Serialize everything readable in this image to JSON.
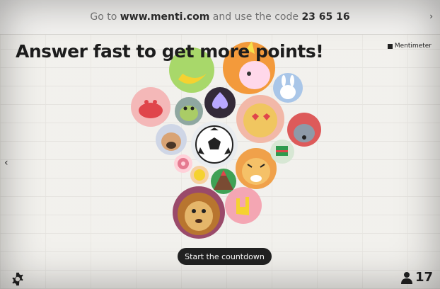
{
  "topbar": {
    "prefix": "Go to",
    "url": "www.menti.com",
    "middle": "and use the code",
    "code": "23 65 16",
    "arrow": "›"
  },
  "title": "Answer fast to get more points!",
  "brand": "Mentimeter",
  "nav": {
    "left_arrow": "‹"
  },
  "start_button": "Start the countdown",
  "participants": {
    "count": "17",
    "icon": "person-icon"
  },
  "settings": {
    "icon": "gear-icon"
  },
  "avatars": [
    "banana-avatar",
    "unicorn-avatar",
    "bunny-avatar",
    "crab-avatar",
    "frog-avatar",
    "spade-avatar",
    "heart-eyes-avatar",
    "wolf-avatar",
    "pug-avatar",
    "soccer-ball-avatar",
    "donut-avatar",
    "tiger-avatar",
    "flag-avatar",
    "emoji-avatar",
    "volcano-avatar",
    "lion-avatar",
    "rock-hand-avatar"
  ]
}
